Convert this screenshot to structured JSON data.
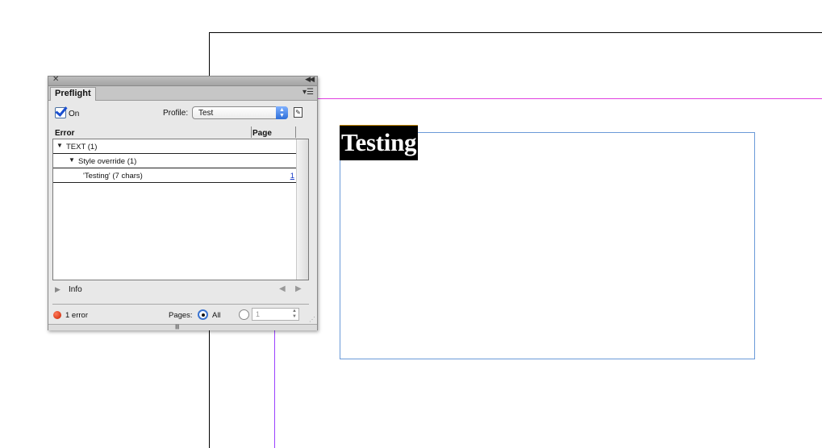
{
  "document": {
    "frame_text": "Testing"
  },
  "panel": {
    "tab_label": "Preflight",
    "on_label": "On",
    "profile_label": "Profile:",
    "profile_value": "Test",
    "columns": {
      "error": "Error",
      "page": "Page"
    },
    "rows": [
      {
        "label": "TEXT (1)",
        "page": ""
      },
      {
        "label": "Style override (1)",
        "page": ""
      },
      {
        "label": "'Testing' (7 chars)",
        "page": "1"
      }
    ],
    "info_label": "Info",
    "status_text": "1 error",
    "status_color": "#d02a10",
    "pages_label": "Pages:",
    "all_label": "All",
    "page_range_value": "1"
  },
  "icons": {
    "close": "close-icon",
    "collapse": "collapse-panel-icon",
    "panel_menu": "panel-menu-icon",
    "define_profiles": "define-profiles-icon",
    "disclosure": "disclosure-triangle-icon"
  },
  "colors": {
    "accent": "#3a73d0",
    "guide_magenta": "#e040e0",
    "guide_violet": "#9a40ff",
    "frame_edge": "#6a9ad8"
  }
}
